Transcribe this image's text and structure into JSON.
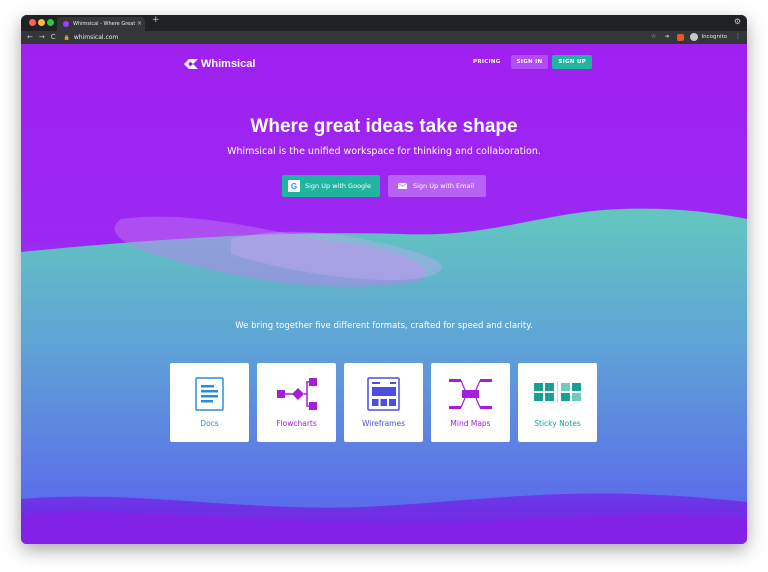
{
  "browser": {
    "tab_title": "Whimsical - Where Great Ideas Take Shape",
    "tab_close": "×",
    "new_tab": "+",
    "settings": "⚙",
    "back": "←",
    "forward": "→",
    "reload": "C",
    "lock": "🔒",
    "url": "whimsical.com",
    "bookmark": "☆",
    "extension": "➜",
    "profile_label": "Incognito",
    "menu": "⋮"
  },
  "nav": {
    "logo_text": "Whimsical",
    "pricing": "PRICING",
    "sign_in": "SIGN IN",
    "sign_up": "SIGN UP"
  },
  "hero": {
    "title": "Where great ideas take shape",
    "subtitle": "Whimsical is the unified workspace for thinking and collaboration.",
    "google_letter": "G",
    "google_button": "Sign Up with Google",
    "email_button": "Sign Up with Email"
  },
  "formats": {
    "tagline": "We bring together five different formats, crafted for speed and clarity.",
    "items": [
      {
        "label": "Docs",
        "icon": "doc-icon",
        "color": "#2b8fd6"
      },
      {
        "label": "Flowcharts",
        "icon": "flowchart-icon",
        "color": "#a51fd8"
      },
      {
        "label": "Wireframes",
        "icon": "wireframe-icon",
        "color": "#4b4fe0"
      },
      {
        "label": "Mind Maps",
        "icon": "mindmap-icon",
        "color": "#a51fd8"
      },
      {
        "label": "Sticky Notes",
        "icon": "sticky-notes-icon",
        "color": "#1a9f95"
      }
    ]
  },
  "colors": {
    "accent_teal": "#20b5a0",
    "purple": "#a020f0"
  }
}
